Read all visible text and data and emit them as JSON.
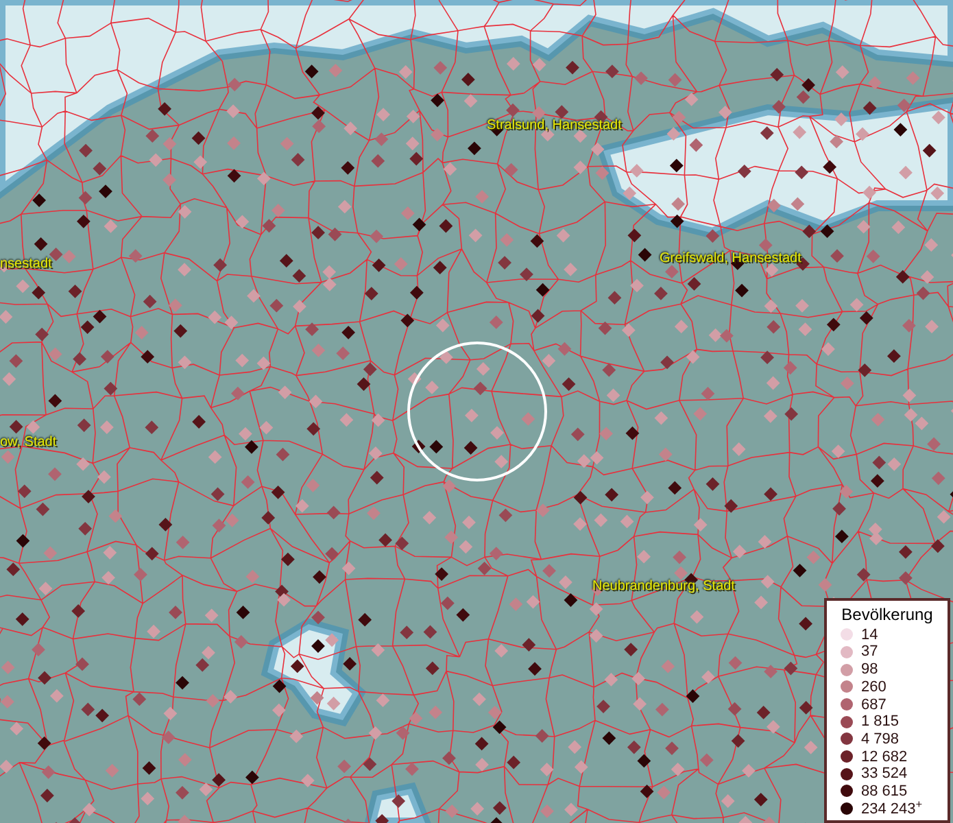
{
  "map": {
    "place_labels": [
      {
        "text": "Stralsund, Hansestadt"
      },
      {
        "text": "nsestadt"
      },
      {
        "text": "Greifswald, Hansestadt"
      },
      {
        "text": "ow, Stadt"
      },
      {
        "text": "Neubrandenburg, Stadt"
      }
    ]
  },
  "legend": {
    "title": "Bevölkerung",
    "entries": [
      {
        "label": "14",
        "color": "#f3dde6"
      },
      {
        "label": "37",
        "color": "#e2b9c3"
      },
      {
        "label": "98",
        "color": "#d29ea6"
      },
      {
        "label": "260",
        "color": "#c3838b"
      },
      {
        "label": "687",
        "color": "#b06470"
      },
      {
        "label": "1 815",
        "color": "#9a4a55"
      },
      {
        "label": "4 798",
        "color": "#833640"
      },
      {
        "label": "12 682",
        "color": "#6c2229"
      },
      {
        "label": "33 524",
        "color": "#561419"
      },
      {
        "label": "88 615",
        "color": "#400a0d"
      },
      {
        "label": "234 243$^{+}$",
        "color": "#2a0506"
      }
    ]
  }
}
